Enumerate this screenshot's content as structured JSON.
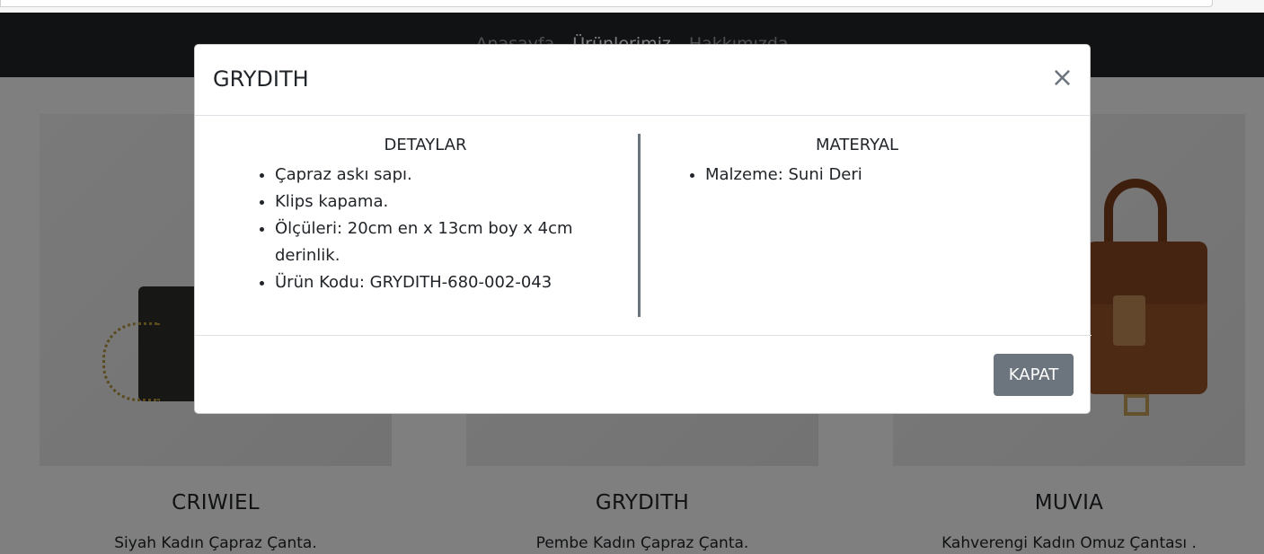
{
  "navbar": {
    "links": [
      "Anasayfa",
      "Ürünlerimiz",
      "Hakkımızda"
    ]
  },
  "products": [
    {
      "title": "CRIWIEL",
      "description": "Siyah Kadın Çapraz Çanta."
    },
    {
      "title": "GRYDITH",
      "description": "Pembe Kadın Çapraz Çanta."
    },
    {
      "title": "MUVIA",
      "description": "Kahverengi Kadın Omuz Çantası ."
    }
  ],
  "modal": {
    "title": "GRYDITH",
    "close_symbol": "×",
    "details_heading": "DETAYLAR",
    "details": [
      "Çapraz askı sapı.",
      "Klips kapama.",
      "Ölçüleri: 20cm en x 13cm boy x 4cm derinlik.",
      "Ürün Kodu: GRYDITH-680-002-043"
    ],
    "material_heading": "MATERYAL",
    "materials": [
      "Malzeme: Suni Deri"
    ],
    "button_label": "KAPAT"
  },
  "colors": {
    "navbar_bg": "#212529",
    "button_bg": "#6c757d",
    "backdrop": "rgba(0,0,0,0.5)"
  },
  "icons": {
    "close": "close-icon"
  }
}
